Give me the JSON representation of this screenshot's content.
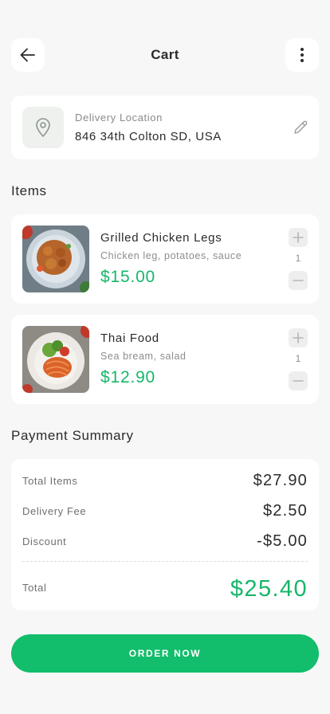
{
  "header": {
    "title": "Cart"
  },
  "location": {
    "label": "Delivery Location",
    "address": "846 34th Colton SD, USA"
  },
  "items_section": {
    "title": "Items"
  },
  "items": [
    {
      "name": "Grilled Chicken Legs",
      "description": "Chicken leg, potatoes, sauce",
      "price": "$15.00",
      "quantity": "1"
    },
    {
      "name": "Thai Food",
      "description": "Sea bream, salad",
      "price": "$12.90",
      "quantity": "1"
    }
  ],
  "payment": {
    "title": "Payment Summary",
    "rows": [
      {
        "label": "Total Items",
        "value": "$27.90"
      },
      {
        "label": "Delivery Fee",
        "value": "$2.50"
      },
      {
        "label": "Discount",
        "value": "-$5.00"
      }
    ],
    "total": {
      "label": "Total",
      "value": "$25.40"
    }
  },
  "cta": {
    "label": "ORDER NOW"
  },
  "colors": {
    "accent": "#12bd6b",
    "price": "#16b76a",
    "background": "#f7f7f7",
    "card": "#ffffff"
  },
  "icons": [
    "arrow-left-icon",
    "more-vertical-icon",
    "location-pin-icon",
    "pencil-icon",
    "plus-icon",
    "minus-icon"
  ]
}
